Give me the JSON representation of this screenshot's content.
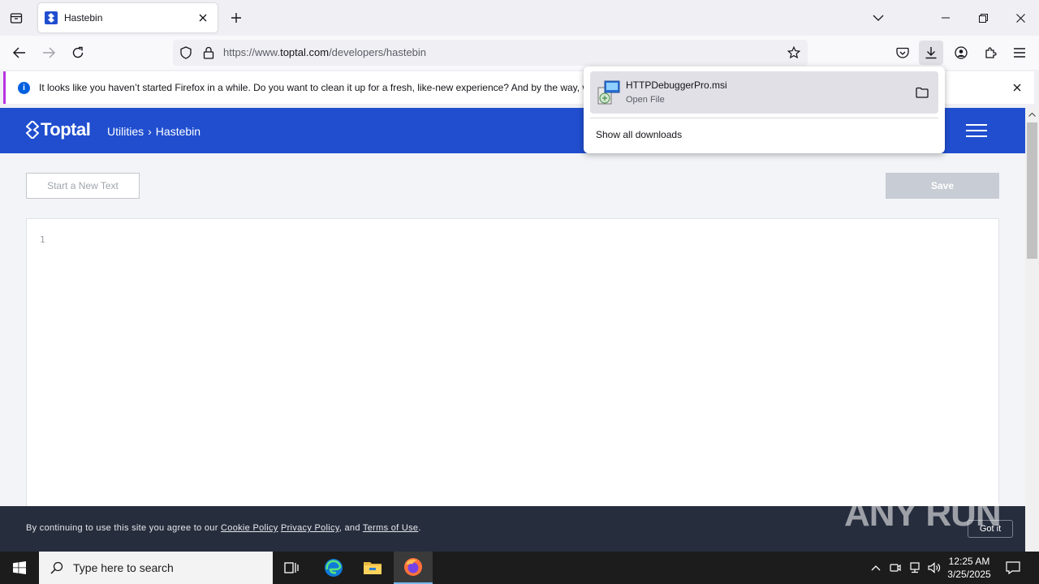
{
  "browser": {
    "tab": {
      "title": "Hastebin"
    },
    "url": {
      "prefix": "https://www.",
      "domain": "toptal.com",
      "path": "/developers/hastebin"
    },
    "notification": {
      "message": "It looks like you haven’t started Firefox in a while. Do you want to clean it up for a fresh, like-new experience? And by the way, welcome back!"
    }
  },
  "downloads": {
    "item": {
      "filename": "HTTPDebuggerPro.msi",
      "status": "Open File"
    },
    "show_all": "Show all downloads"
  },
  "site": {
    "logo": "Toptal",
    "breadcrumb": {
      "parent": "Utilities",
      "separator": "›",
      "current": "Hastebin"
    },
    "new_text_button": "Start a New Text",
    "save_button": "Save",
    "editor": {
      "line_number": "1"
    },
    "cookie": {
      "prefix": "By continuing to use this site you agree to our ",
      "cookie_policy": "Cookie Policy",
      "space": " ",
      "privacy_policy": "Privacy Policy",
      "and": ", and ",
      "terms": "Terms of Use",
      "suffix": ".",
      "got_it": "Got it"
    },
    "watermark": "ANY RUN"
  },
  "taskbar": {
    "search_placeholder": "Type here to search",
    "time": "12:25 AM",
    "date": "3/25/2025"
  },
  "colors": {
    "brand": "#204ecf",
    "cookie_bg": "#262d3d",
    "notification_accent": "#b833e1"
  }
}
